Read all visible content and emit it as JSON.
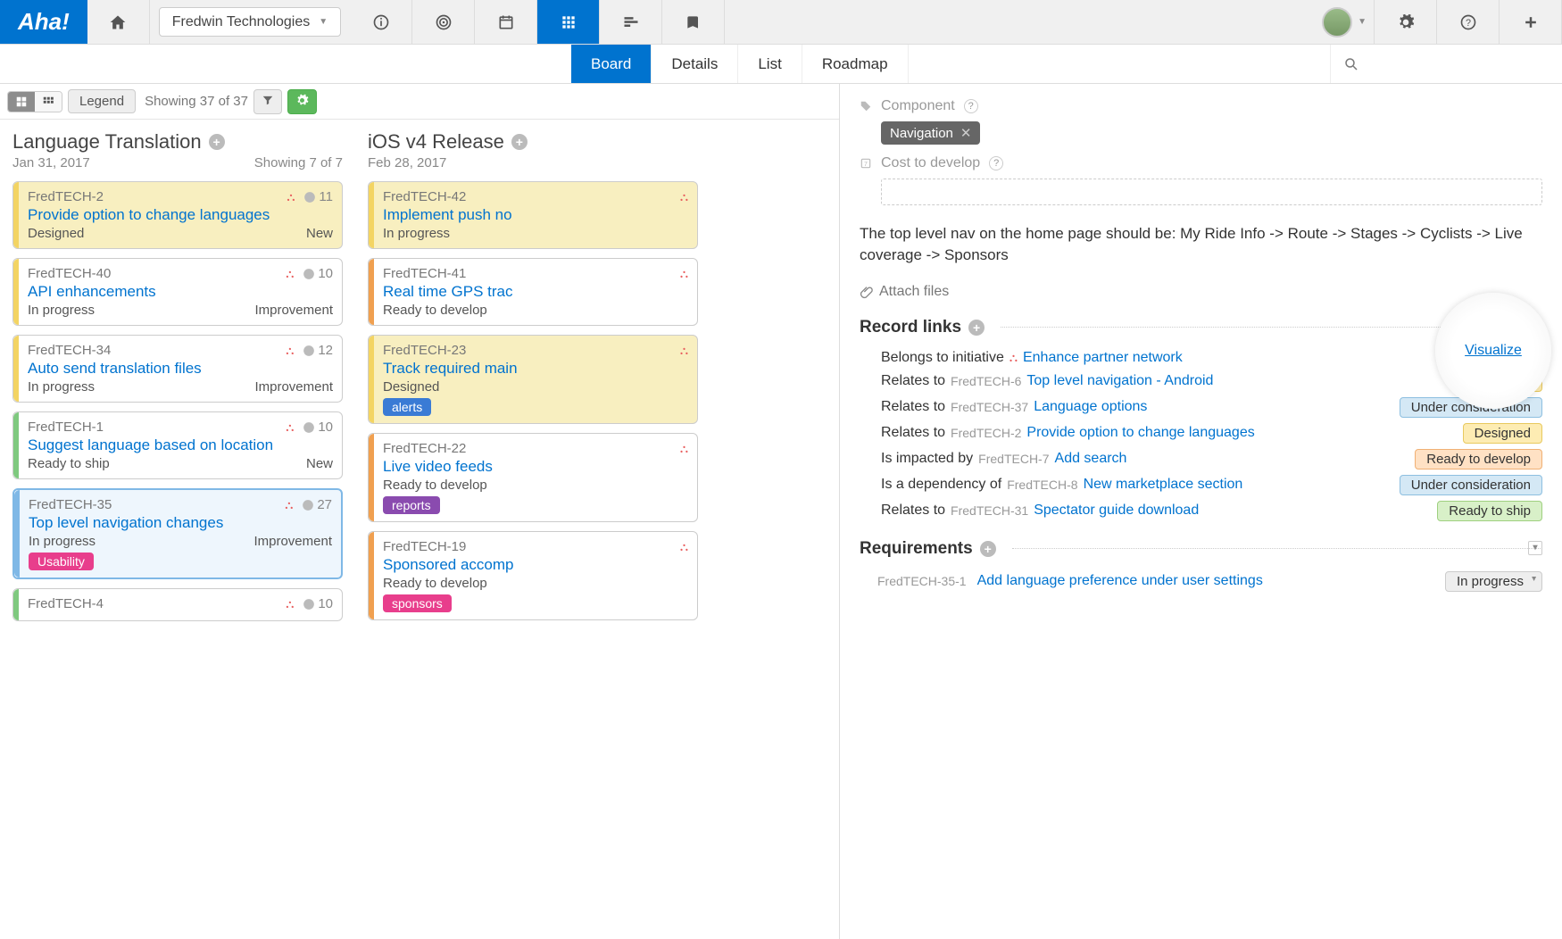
{
  "nav": {
    "logo": "Aha!",
    "workspace": "Fredwin Technologies"
  },
  "subnav": {
    "tabs": [
      "Board",
      "Details",
      "List",
      "Roadmap"
    ],
    "active": "Board"
  },
  "toolbar": {
    "legend": "Legend",
    "showing": "Showing 37 of 37"
  },
  "columns": [
    {
      "title": "Language Translation",
      "date": "Jan 31, 2017",
      "showing": "Showing 7 of 7",
      "cards": [
        {
          "ref": "FredTECH-2",
          "title": "Provide option to change languages",
          "status": "Designed",
          "type": "New",
          "count": "11",
          "stripe": "yellow",
          "bg": "yellow"
        },
        {
          "ref": "FredTECH-40",
          "title": "API enhancements",
          "status": "In progress",
          "type": "Improvement",
          "count": "10",
          "stripe": "yellow"
        },
        {
          "ref": "FredTECH-34",
          "title": "Auto send translation files",
          "status": "In progress",
          "type": "Improvement",
          "count": "12",
          "stripe": "yellow"
        },
        {
          "ref": "FredTECH-1",
          "title": "Suggest language based on location",
          "status": "Ready to ship",
          "type": "New",
          "count": "10",
          "stripe": "green"
        },
        {
          "ref": "FredTECH-35",
          "title": "Top level navigation changes",
          "status": "In progress",
          "type": "Improvement",
          "count": "27",
          "stripe": "blue",
          "selected": true,
          "tag": "Usability",
          "tagClass": "tag-pink"
        },
        {
          "ref": "FredTECH-4",
          "title": "",
          "status": "",
          "type": "",
          "count": "10",
          "stripe": "green"
        }
      ]
    },
    {
      "title": "iOS v4 Release",
      "date": "Feb 28, 2017",
      "showing": "",
      "cards": [
        {
          "ref": "FredTECH-42",
          "title": "Implement push no",
          "status": "In progress",
          "type": "",
          "count": "",
          "stripe": "yellow",
          "bg": "yellow"
        },
        {
          "ref": "FredTECH-41",
          "title": "Real time GPS trac",
          "status": "Ready to develop",
          "type": "",
          "count": "",
          "stripe": "orange"
        },
        {
          "ref": "FredTECH-23",
          "title": "Track required main",
          "status": "Designed",
          "type": "",
          "count": "",
          "stripe": "yellow",
          "bg": "yellow",
          "tag": "alerts",
          "tagClass": "tag-blue"
        },
        {
          "ref": "FredTECH-22",
          "title": "Live video feeds",
          "status": "Ready to develop",
          "type": "",
          "count": "",
          "stripe": "orange",
          "tag": "reports",
          "tagClass": "tag-purple"
        },
        {
          "ref": "FredTECH-19",
          "title": "Sponsored accomp",
          "status": "Ready to develop",
          "type": "",
          "count": "",
          "stripe": "orange",
          "tag": "sponsors",
          "tagClass": "tag-pink"
        }
      ]
    }
  ],
  "detail": {
    "componentLabel": "Component",
    "componentChip": "Navigation",
    "costLabel": "Cost to develop",
    "description": "The top level nav on the home page should be: My Ride Info -> Route -> Stages -> Cyclists -> Live coverage -> Sponsors",
    "attach": "Attach files",
    "recordLinksTitle": "Record links",
    "visualize": "Visualize",
    "links": [
      {
        "rel": "Belongs to initiative",
        "ref": "",
        "name": "Enhance partner network",
        "status": "",
        "statusClass": "",
        "hier": true
      },
      {
        "rel": "Relates to",
        "ref": "FredTECH-6",
        "name": "Top level navigation - Android",
        "status": "Designed",
        "statusClass": "st-designed"
      },
      {
        "rel": "Relates to",
        "ref": "FredTECH-37",
        "name": "Language options",
        "status": "Under consideration",
        "statusClass": "st-under"
      },
      {
        "rel": "Relates to",
        "ref": "FredTECH-2",
        "name": "Provide option to change languages",
        "status": "Designed",
        "statusClass": "st-designed"
      },
      {
        "rel": "Is impacted by",
        "ref": "FredTECH-7",
        "name": "Add search",
        "status": "Ready to develop",
        "statusClass": "st-readydev"
      },
      {
        "rel": "Is a dependency of",
        "ref": "FredTECH-8",
        "name": "New marketplace section",
        "status": "Under consideration",
        "statusClass": "st-under"
      },
      {
        "rel": "Relates to",
        "ref": "FredTECH-31",
        "name": "Spectator guide download",
        "status": "Ready to ship",
        "statusClass": "st-readyship"
      }
    ],
    "requirementsTitle": "Requirements",
    "requirements": [
      {
        "ref": "FredTECH-35-1",
        "name": "Add language preference under user settings",
        "status": "In progress"
      }
    ]
  }
}
